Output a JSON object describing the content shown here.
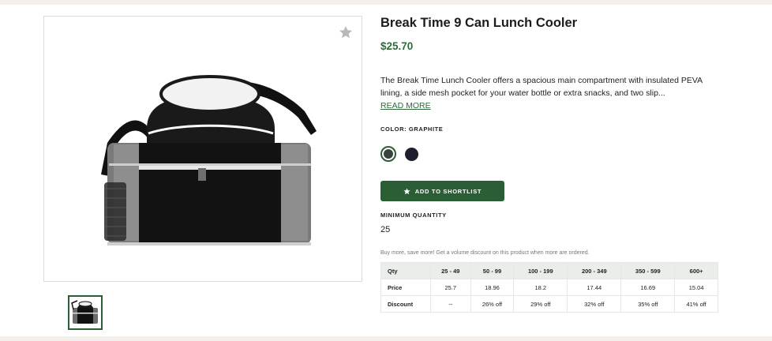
{
  "product": {
    "title": "Break Time 9 Can Lunch Cooler",
    "price": "$25.70",
    "description": "The Break Time Lunch Cooler offers a spacious main compartment with insulated PEVA lining, a side mesh pocket for your water bottle or extra snacks, and two slip...",
    "read_more_label": "READ MORE",
    "color_label": "COLOR: GRAPHITE",
    "colors": [
      {
        "name": "Graphite",
        "hex": "#3b4040",
        "selected": true
      },
      {
        "name": "Navy",
        "hex": "#1e1f2e",
        "selected": false
      }
    ],
    "shortlist_label": "ADD TO SHORTLIST",
    "min_quantity_label": "MINIMUM QUANTITY",
    "min_quantity_value": "25",
    "discount_note": "Buy more, save more! Get a volume discount on this product when more are ordered."
  },
  "pricing_table": {
    "headers": [
      "Qty",
      "25 - 49",
      "50 - 99",
      "100 - 199",
      "200 - 349",
      "350 - 599",
      "600+"
    ],
    "rows": [
      [
        "Price",
        "25.7",
        "18.96",
        "18.2",
        "17.44",
        "16.69",
        "15.04"
      ],
      [
        "Discount",
        "--",
        "26% off",
        "29% off",
        "32% off",
        "35% off",
        "41% off"
      ]
    ]
  },
  "icons": {
    "favorite": "star-icon",
    "shortlist": "star-icon"
  },
  "colors": {
    "brand_green": "#2c5e36",
    "price_green": "#2f6a3b",
    "background": "#f3efea"
  }
}
